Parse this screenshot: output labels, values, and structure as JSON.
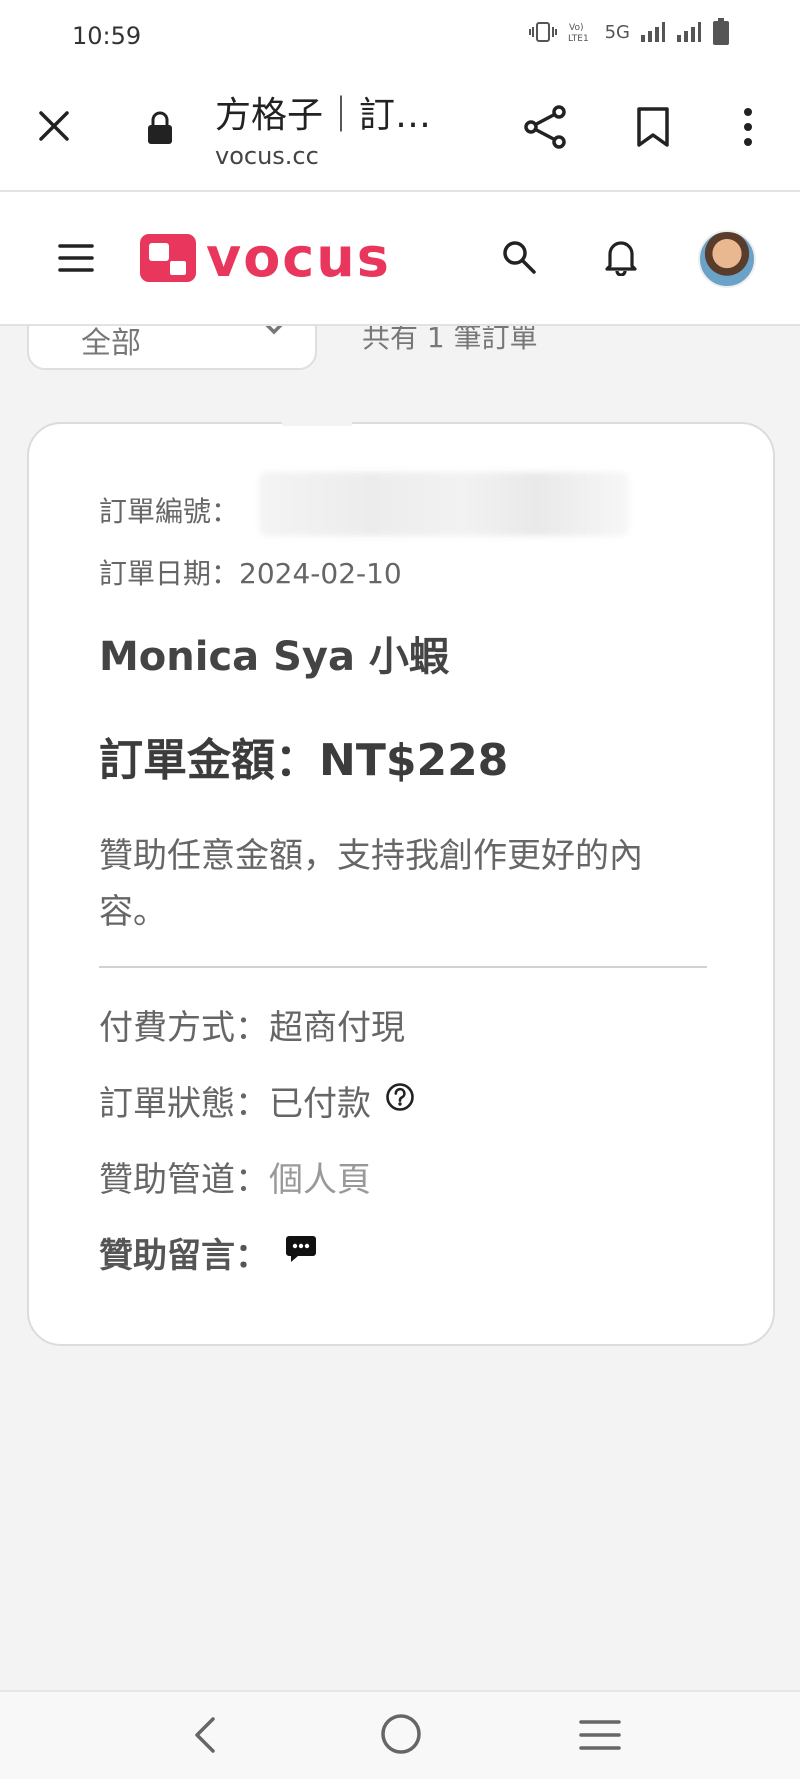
{
  "status_bar": {
    "time": "10:59",
    "network": "5G",
    "volte": "VoLTE1"
  },
  "browser": {
    "title": "方格子｜訂…",
    "url": "vocus.cc"
  },
  "site": {
    "logo_text": "vocus",
    "brand_color": "#e8365d"
  },
  "filter": {
    "selected": "全部",
    "count_text": "共有 1 筆訂單"
  },
  "order": {
    "number_label": "訂單編號：",
    "date_label": "訂單日期：",
    "date_value": "2024-02-10",
    "creator_name": "Monica Sya 小蝦",
    "amount_label": "訂單金額：",
    "amount_value": "NT$228",
    "description": "贊助任意金額，支持我創作更好的內容。",
    "payment_label": "付費方式：",
    "payment_value": "超商付現",
    "status_label": "訂單狀態：",
    "status_value": "已付款",
    "channel_label": "贊助管道：",
    "channel_value": "個人頁",
    "message_label": "贊助留言："
  },
  "icons": {
    "close": "close-icon",
    "lock": "lock-icon",
    "share": "share-icon",
    "bookmark": "bookmark-icon",
    "more": "more-vert-icon",
    "menu": "menu-icon",
    "search": "search-icon",
    "bell": "bell-icon",
    "help": "help-circle-icon",
    "message": "chat-bubble-icon"
  }
}
